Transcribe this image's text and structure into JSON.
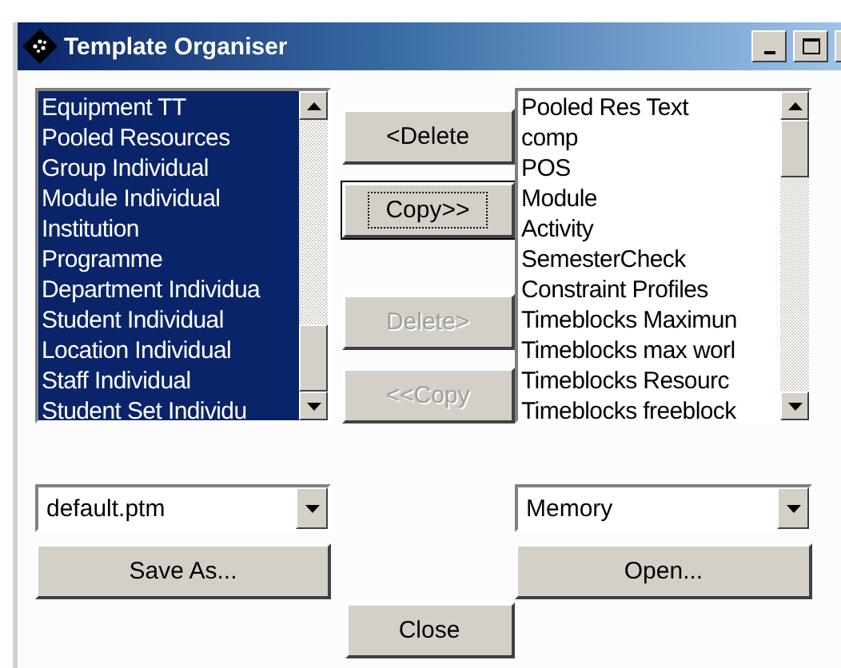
{
  "window": {
    "title": "Template Organiser"
  },
  "left_list": {
    "items": [
      {
        "label": "Equipment TT",
        "selected": true
      },
      {
        "label": "Pooled Resources",
        "selected": true
      },
      {
        "label": "Group Individual",
        "selected": true
      },
      {
        "label": "Module Individual",
        "selected": true
      },
      {
        "label": "Institution",
        "selected": true
      },
      {
        "label": "Programme",
        "selected": true
      },
      {
        "label": "Department Individua",
        "selected": true
      },
      {
        "label": "Student Individual",
        "selected": true
      },
      {
        "label": "Location Individual",
        "selected": true
      },
      {
        "label": "Staff Individual",
        "selected": true
      },
      {
        "label": "Student Set Individu",
        "selected": true
      }
    ]
  },
  "right_list": {
    "items": [
      {
        "label": "Pooled Res Text",
        "selected": false
      },
      {
        "label": "comp",
        "selected": false
      },
      {
        "label": "POS",
        "selected": false
      },
      {
        "label": "Module",
        "selected": false
      },
      {
        "label": "Activity",
        "selected": false
      },
      {
        "label": "SemesterCheck",
        "selected": false
      },
      {
        "label": "Constraint Profiles",
        "selected": false
      },
      {
        "label": "Timeblocks Maximun",
        "selected": false
      },
      {
        "label": "Timeblocks max worl",
        "selected": false
      },
      {
        "label": "Timeblocks Resourc",
        "selected": false
      },
      {
        "label": "Timeblocks freeblock",
        "selected": false
      }
    ]
  },
  "middle_buttons": [
    {
      "label": "<Delete",
      "disabled": false,
      "focused": false
    },
    {
      "label": "Copy>>",
      "disabled": false,
      "focused": true
    },
    {
      "label": "Delete>",
      "disabled": true,
      "focused": false
    },
    {
      "label": "<<Copy",
      "disabled": true,
      "focused": false
    }
  ],
  "left_combo": {
    "value": "default.ptm"
  },
  "right_combo": {
    "value": "Memory"
  },
  "save_button": {
    "label": "Save As..."
  },
  "open_button": {
    "label": "Open..."
  },
  "close_button": {
    "label": "Close"
  }
}
